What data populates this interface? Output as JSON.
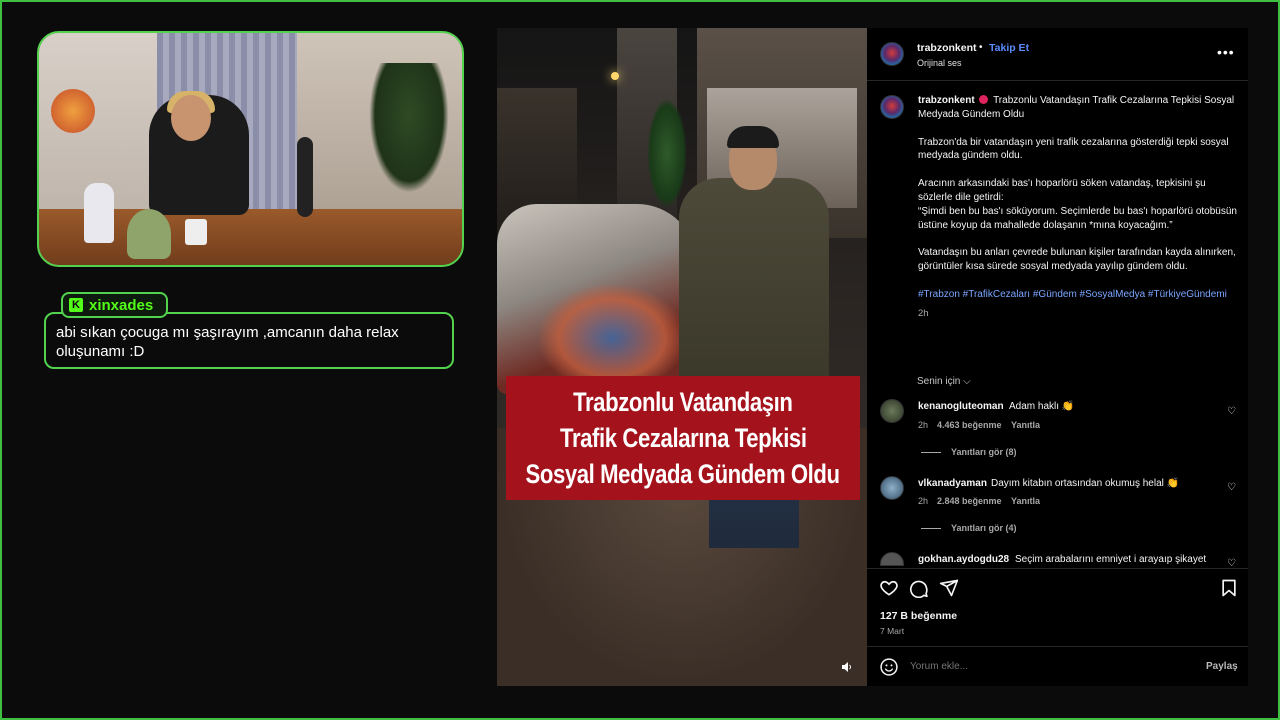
{
  "chat": {
    "username": "xinxades",
    "message": "abi sıkan çocuga mı şaşırayım ,amcanın daha relax oluşunamı :D"
  },
  "video": {
    "banner_lines": [
      "Trabzonlu Vatandaşın",
      "Trafik Cezalarına Tepkisi",
      "Sosyal Medyada Gündem Oldu"
    ],
    "sound_icon": "speaker-icon"
  },
  "post": {
    "header": {
      "username": "trabzonkent",
      "dot": "•",
      "follow_label": "Takip Et",
      "audio": "Orijinal ses"
    },
    "caption": {
      "username": "trabzonkent",
      "title": "Trabzonlu Vatandaşın Trafik Cezalarına Tepkisi Sosyal Medyada Gündem Oldu",
      "p1": "Trabzon'da bir vatandaşın yeni trafik cezalarına gösterdiği tepki sosyal medyada gündem oldu.",
      "p2a": "Aracının arkasındaki bas'ı hoparlörü söken vatandaş, tepkisini şu sözlerle dile getirdi:",
      "p2b": "“Şimdi ben bu bas'ı söküyorum. Seçimlerde bu bas'ı hoparlörü otobüsün üstüne koyup da mahallede dolaşanın *mına koyacağım.”",
      "p3": "Vatandaşın bu anları çevrede bulunan kişiler tarafından kayda alınırken, görüntüler kısa sürede sosyal medyada yayılıp gündem oldu.",
      "tags": "#Trabzon #TrafikCezaları #Gündem #SosyalMedya #TürkiyeGündemi",
      "time": "2h"
    },
    "sort_label": "Senin için",
    "comments": [
      {
        "user": "kenanogluteoman",
        "text": "Adam haklı 👏",
        "time": "2h",
        "likes": "4.463 beğenme",
        "reply": "Yanıtla",
        "view_replies": "Yanıtları gör (8)"
      },
      {
        "user": "vlkanadyaman",
        "text": "Dayım kitabın ortasından okumuş helal 👏",
        "time": "2h",
        "likes": "2.848 beğenme",
        "reply": "Yanıtla",
        "view_replies": "Yanıtları gör (4)"
      },
      {
        "user": "gokhan.aydogdu28",
        "text": "Seçim arabalarını emniyet i arayaıp şikayet"
      }
    ],
    "likes_total": "127 B beğenme",
    "date": "7 Mart",
    "comment_placeholder": "Yorum ekle...",
    "share_label": "Paylaş"
  },
  "colors": {
    "accent_green": "#53d24e",
    "kick_green": "#53fc18",
    "banner_red": "#a4131c",
    "link_blue": "#5b8cff"
  }
}
